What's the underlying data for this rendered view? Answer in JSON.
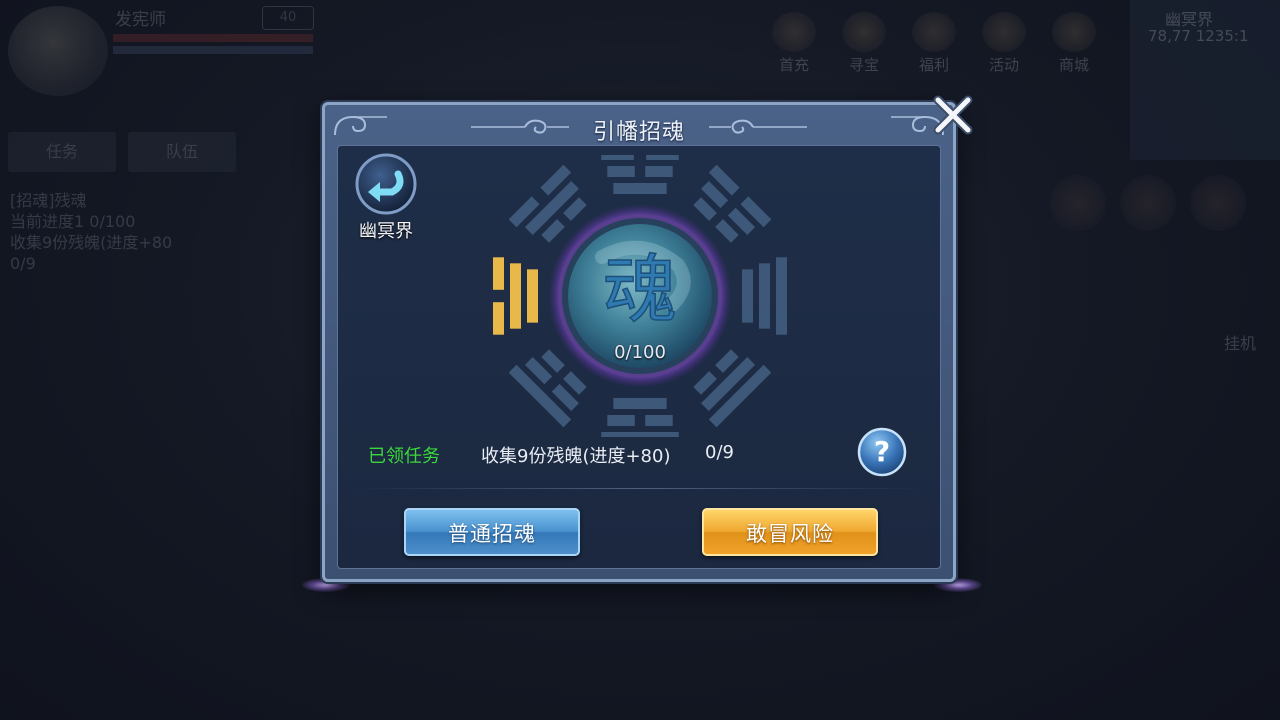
{
  "background_hud": {
    "player_name": "发宪师",
    "player_level": "40",
    "tabs": [
      "任务",
      "队伍"
    ],
    "quest_text": [
      "[招魂]残魂",
      "当前进度1 0/100",
      "收集9份残魄(进度+80",
      "0/9"
    ],
    "top_icons": [
      "首充",
      "寻宝",
      "福利",
      "活动",
      "商城"
    ],
    "map_name": "幽冥界",
    "map_coord": "78,77 1235:1",
    "auto_label": "挂机"
  },
  "dialog": {
    "title": "引幡招魂",
    "back_label": "幽冥界",
    "progress": "0/100",
    "emblem_glyph": "魂",
    "task_status": "已领任务",
    "task_desc": "收集9份残魄(进度+80)",
    "task_count": "0/9",
    "help_glyph": "?",
    "normal_button": "普通招魂",
    "risk_button": "敢冒风险"
  },
  "colors": {
    "task_status": "#3bd83b",
    "normal_button": "#4a92cf",
    "risk_button": "#f0a830",
    "highlight_trigram": "#e8b84a",
    "trigram": "#3e5879"
  }
}
